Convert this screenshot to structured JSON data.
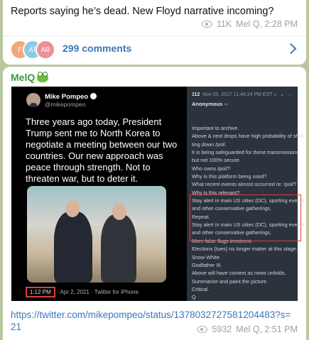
{
  "message1": {
    "text": "Reports saying he’s dead. New Floyd narrative incoming?",
    "views": "11K",
    "signature": "Mel Q, 2:28 PM",
    "comments": {
      "avatars": [
        "F",
        "AT",
        "AB"
      ],
      "label": "299 comments"
    }
  },
  "message2": {
    "sender": "MelQ",
    "tweet": {
      "author": "Mike Pompeo",
      "handle": "@mikepompeo",
      "body": "Three years ago today, President Trump sent me to North Korea to negotiate a meeting between our two countries. Our new approach was peace through strength. Not to threaten war, but to deter it.",
      "time": "1:12 PM",
      "time_rest": " · Apr 2, 2021 · Twitter for iPhone"
    },
    "post": {
      "number": "112",
      "date": "Nov 05, 2017 11:46:24 PM EST",
      "author": "Anonymous",
      "lines": [
        "Important to archive.",
        "Above & next drops have high probability of shut-",
        "ting down /pol/.",
        "It is being safeguarded for these transmissions",
        "but not 100% secure.",
        "Who owns /pol/?",
        "Why is this platform being used?",
        "What recent events almost occurred re: /pol/?",
        "Why is this relevant?",
        "Stay alert in main US cities (DC), sporting events,",
        "and other conservative gatherings.",
        "Repeat.",
        "Stay alert in main US cities (DC), sporting events,",
        "and other conservative gatherings.",
        "More false flags imminent.",
        "Elections (tues) no longer matter at this stage.",
        "Snow White.",
        "Godfather III.",
        "Above will have context as news unfolds.",
        "Summarize and paint the picture.",
        "Critical.",
        "Q"
      ]
    },
    "link": "https://twitter.com/mikepompeo/status/1378032727581204483?s=21",
    "views": "5932",
    "signature": "Mel Q, 2:51 PM"
  },
  "colors": {
    "background": "#b9c79f",
    "link": "#3a78b8",
    "sender": "#3a9a3a",
    "highlight": "#e03c3c"
  },
  "icons": [
    "eye-icon",
    "chevron-right-icon",
    "frog-emoji-icon",
    "verified-badge-icon",
    "link-icon"
  ]
}
